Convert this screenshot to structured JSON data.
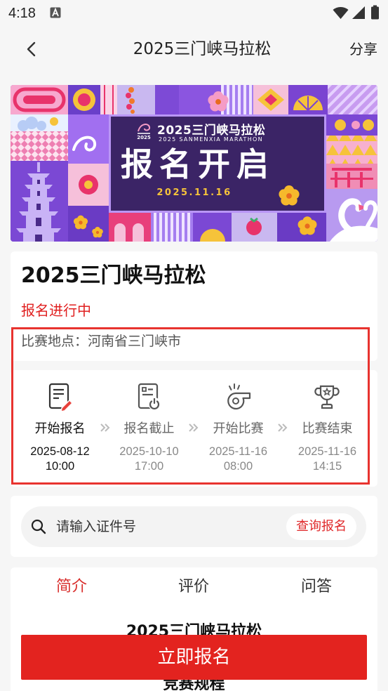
{
  "status_bar": {
    "time": "4:18",
    "icons": [
      "a-notification-icon",
      "wifi-icon",
      "signal-icon",
      "battery-icon"
    ]
  },
  "header": {
    "back_icon": "back-arrow-icon",
    "title": "2025三门峡马拉松",
    "share_label": "分享"
  },
  "banner": {
    "logo_text": "2025",
    "title": "2025三门峡马拉松",
    "subtitle": "2025 SANMENXIA MARATHON",
    "headline": "报名开启",
    "date": "2025.11.16"
  },
  "event": {
    "name": "2025三门峡马拉松",
    "status": "报名进行中",
    "location_label": "比赛地点：",
    "location": "河南省三门峡市"
  },
  "timeline": [
    {
      "label": "开始报名",
      "date": "2025-08-12",
      "time": "10:00",
      "icon": "registration-form-icon",
      "active": true
    },
    {
      "label": "报名截止",
      "date": "2025-10-10",
      "time": "17:00",
      "icon": "registration-closed-icon",
      "active": false
    },
    {
      "label": "开始比赛",
      "date": "2025-11-16",
      "time": "08:00",
      "icon": "whistle-icon",
      "active": false
    },
    {
      "label": "比赛结束",
      "date": "2025-11-16",
      "time": "14:15",
      "icon": "trophy-icon",
      "active": false
    }
  ],
  "search": {
    "icon": "search-icon",
    "placeholder": "请输入证件号",
    "button_label": "查询报名"
  },
  "tabs": [
    {
      "label": "简介",
      "active": true
    },
    {
      "label": "评价",
      "active": false
    },
    {
      "label": "问答",
      "active": false
    }
  ],
  "content": {
    "heading": "2025三门峡马拉松",
    "section_title": "竞赛规程"
  },
  "cta": {
    "label": "立即报名"
  },
  "colors": {
    "accent": "#e3231f",
    "status_text": "#e02020",
    "tab_active": "#d9302e",
    "highlight_border": "#e8332f",
    "banner_panel": "#3b2466",
    "banner_date": "#f6c33a"
  }
}
